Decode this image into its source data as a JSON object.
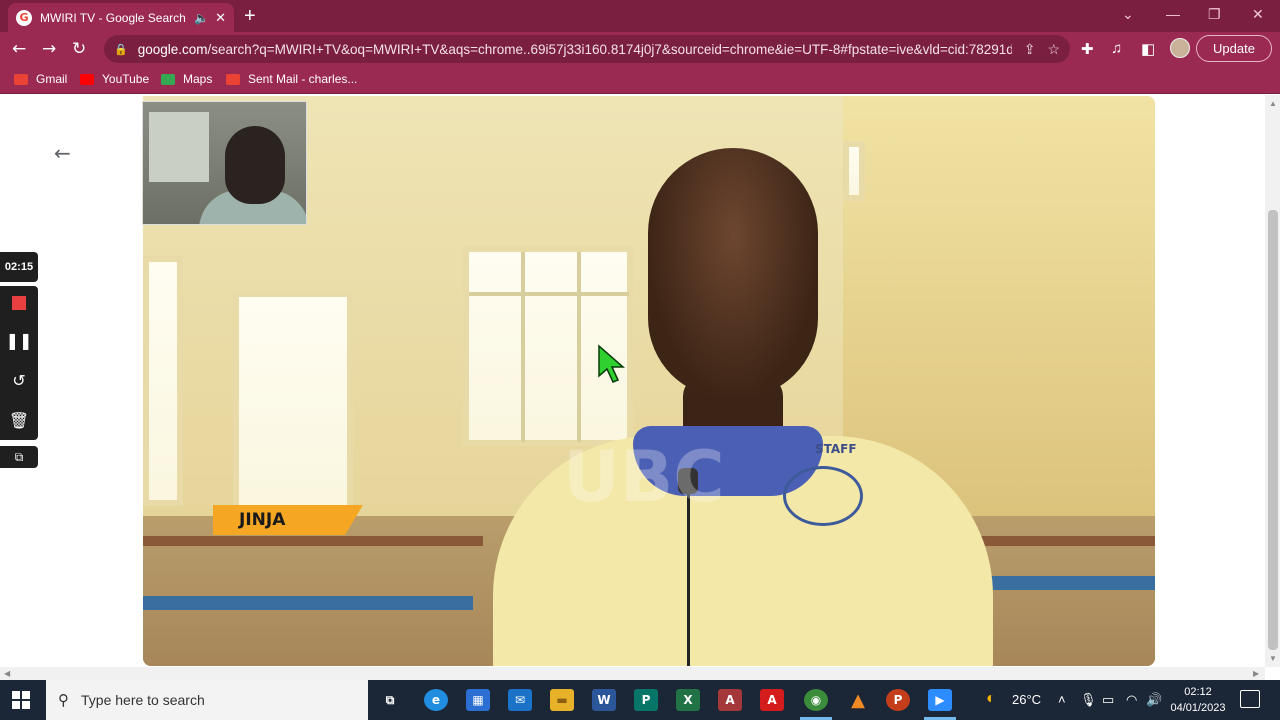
{
  "browser": {
    "tab": {
      "favicon": "G",
      "title": "MWIRI TV - Google Search",
      "audio_icon": "speaker-icon",
      "close_icon": "close-icon"
    },
    "new_tab": "+",
    "window_controls": [
      "⌄",
      "—",
      "❐",
      "✕"
    ],
    "toolbar": {
      "back": "←",
      "forward": "→",
      "reload": "↻",
      "url_host": "google.com",
      "url_path": "/search?q=MWIRI+TV&oq=MWIRI+TV&aqs=chrome..69i57j33i160.8174j0j7&sourceid=chrome&ie=UTF-8#fpstate=ive&vld=cid:78291d...",
      "update_label": "Update"
    },
    "bookmarks": [
      {
        "label": "Gmail",
        "color": "#ea4335"
      },
      {
        "label": "YouTube",
        "color": "#ff0000"
      },
      {
        "label": "Maps",
        "color": "#34a853"
      },
      {
        "label": "Sent Mail - charles...",
        "color": "#ea4335"
      }
    ]
  },
  "page": {
    "back_arrow": "←",
    "video": {
      "location_tag": "JINJA",
      "shirt_text": "STAFF",
      "watermark": "UBC"
    }
  },
  "recorder": {
    "time": "02:15",
    "pause_icon": "❚❚",
    "restart_icon": "↺",
    "delete_icon": "🗑",
    "crop_icon": "⧉"
  },
  "taskbar": {
    "search_placeholder": "Type here to search",
    "search_icon": "⚲",
    "apps": [
      {
        "name": "task-view",
        "label": "⧉",
        "color": "#1b2636"
      },
      {
        "name": "edge",
        "label": "e",
        "color": "#1f8ee0"
      },
      {
        "name": "store",
        "label": "▦",
        "color": "#2a6fd1"
      },
      {
        "name": "mail",
        "label": "✉",
        "color": "#1a73c8"
      },
      {
        "name": "explorer",
        "label": "▬",
        "color": "#e8b12a"
      },
      {
        "name": "word",
        "label": "W",
        "color": "#2b579a"
      },
      {
        "name": "publisher",
        "label": "P",
        "color": "#077568"
      },
      {
        "name": "excel",
        "label": "X",
        "color": "#217346"
      },
      {
        "name": "access",
        "label": "A",
        "color": "#a4373a"
      },
      {
        "name": "acrobat",
        "label": "A",
        "color": "#d41c1c"
      },
      {
        "name": "chrome",
        "label": "◉",
        "color": "#3b8d3b"
      },
      {
        "name": "vlc",
        "label": "▲",
        "color": "#f08a24"
      },
      {
        "name": "powerpoint",
        "label": "P",
        "color": "#c43e1c"
      },
      {
        "name": "zoom",
        "label": "▶",
        "color": "#2d8cff"
      }
    ],
    "weather": "26°C",
    "time": "02:12",
    "date": "04/01/2023"
  }
}
